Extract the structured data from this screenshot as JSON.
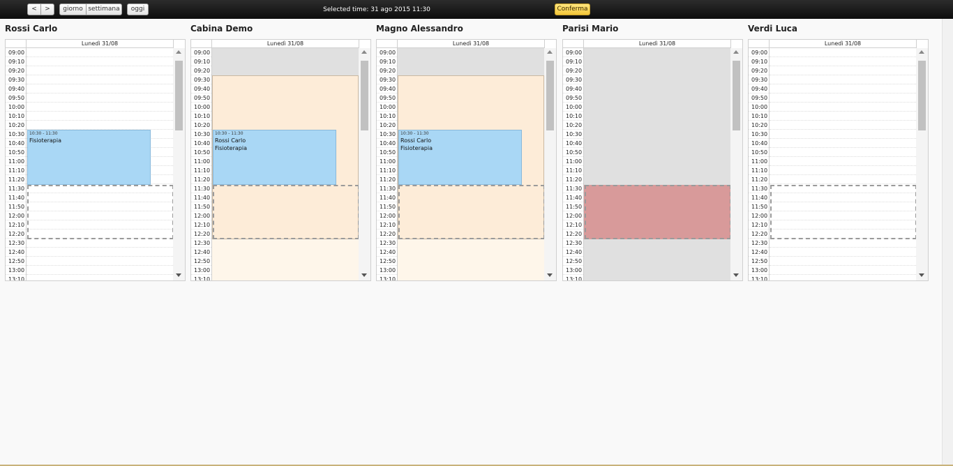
{
  "toolbar": {
    "prev_label": "<",
    "next_label": ">",
    "day_label": "giorno",
    "week_label": "settimana",
    "today_label": "oggi",
    "selected_time": "Selected time: 31 ago 2015 11:30",
    "confirm_label": "Conferma"
  },
  "times": [
    "09:00",
    "09:10",
    "09:20",
    "09:30",
    "09:40",
    "09:50",
    "10:00",
    "10:10",
    "10:20",
    "10:30",
    "10:40",
    "10:50",
    "11:00",
    "11:10",
    "11:20",
    "11:30",
    "11:40",
    "11:50",
    "12:00",
    "12:10",
    "12:20",
    "12:30",
    "12:40",
    "12:50",
    "13:00",
    "13:10"
  ],
  "day_header": "Lunedì 31/08",
  "columns": [
    {
      "name": "Rossi Carlo",
      "event": {
        "time": "10:30 - 11:30",
        "line1": "Fisioterapia",
        "line2": ""
      }
    },
    {
      "name": "Cabina Demo",
      "event": {
        "time": "10:30 - 11:30",
        "line1": "Rossi Carlo",
        "line2": "Fisioterapia"
      }
    },
    {
      "name": "Magno Alessandro",
      "event": {
        "time": "10:30 - 11:30",
        "line1": "Rossi Carlo",
        "line2": "Fisioterapia"
      }
    },
    {
      "name": "Parisi Mario"
    },
    {
      "name": "Verdi Luca"
    }
  ],
  "colors": {
    "event": "#a9d7f5",
    "available": "#fdecd8",
    "unavailable": "#e0e0e0",
    "selection_busy": "#d89a9a",
    "confirm": "#f3c63a"
  }
}
